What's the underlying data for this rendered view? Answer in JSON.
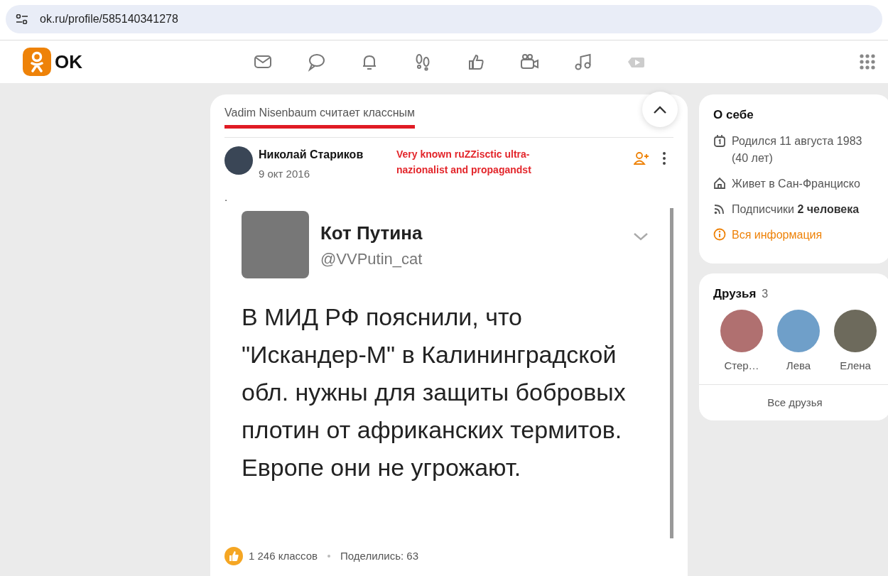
{
  "browser": {
    "url": "ok.ru/profile/585140341278"
  },
  "header": {
    "logo": "OK"
  },
  "post": {
    "liked_by": "Vadim Nisenbaum считает классным",
    "author": "Николай Стариков",
    "date": "9 окт 2016",
    "annotation": "Very known ruZZisctic ultra-nazionalist and propagandst",
    "text": ".",
    "tweet": {
      "name": "Кот Путина",
      "handle": "@VVPutin_cat",
      "text": "В МИД РФ пояснили, что \"Искандер-М\" в Калининградской обл. нужны для защиты бобровых плотин от африканских термитов. Европе они не угрожают."
    },
    "likes": "1 246 классов",
    "shares": "Поделились: 63"
  },
  "about": {
    "title": "О себе",
    "items": [
      {
        "kind": "birthday",
        "text": "Родился 11 августа 1983 (40 лет)"
      },
      {
        "kind": "home",
        "text": "Живет в Сан-Франциско"
      },
      {
        "kind": "subscribers",
        "text": "Подписчики **2 человека**"
      },
      {
        "kind": "info",
        "text": "Вся информация"
      }
    ]
  },
  "friends": {
    "title": "Друзья",
    "count": "3",
    "items": [
      "Стер…",
      "Лева",
      "Елена"
    ],
    "all_link": "Все друзья"
  }
}
